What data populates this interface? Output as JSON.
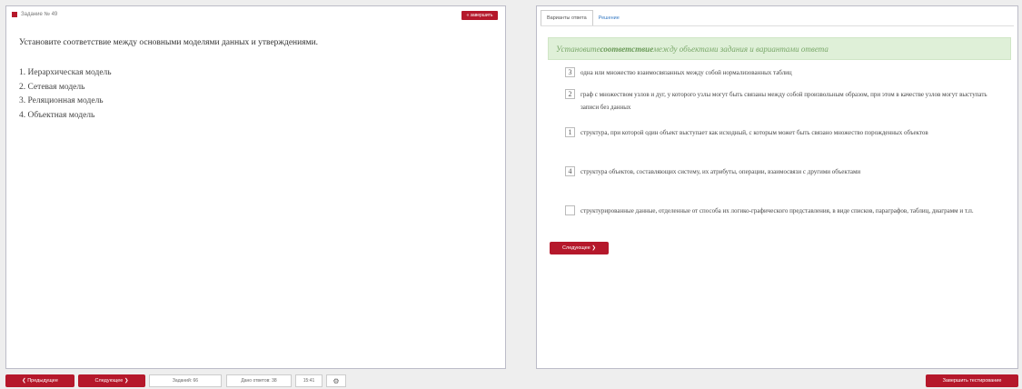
{
  "task": {
    "number_label": "Задание № 49",
    "finish_label": "« завершить",
    "prompt": "Установите соответствие между основными моделями данных и утверждениями.",
    "models": [
      "1. Иерархическая модель",
      "2. Сетевая модель",
      "3. Реляционная модель",
      "4. Объектная модель"
    ]
  },
  "answer_panel": {
    "tabs": [
      {
        "label": "Варианты ответа"
      },
      {
        "label": "Решение"
      }
    ],
    "instruction_pre": "Установите ",
    "instruction_bold": "соответствие",
    "instruction_post": " между объектами задания и вариантами ответа",
    "statements": [
      {
        "value": "3",
        "text": "одна или множество взаимосвязанных между собой нормализованных таблиц"
      },
      {
        "value": "2",
        "text": "граф с множеством узлов и дуг, у которого узлы могут быть связаны между собой произвольным образом, при этом в качестве узлов могут выступать записи без данных"
      },
      {
        "value": "1",
        "text": "структура, при которой один объект выступает как исходный, с которым может быть связано множество порожденных объектов"
      },
      {
        "value": "4",
        "text": "структура объектов, составляющих систему, их атрибуты, операции, взаимосвязи с другими объектами"
      },
      {
        "value": "",
        "text": "структурированные данные, отделенные от способа их логико-графического представления, в виде списков, параграфов, таблиц, диаграмм и т.п."
      }
    ],
    "next_label": "Следующее ❯"
  },
  "bottom_bar": {
    "prev_label": "❮ Предыдущее",
    "next_label": "Следующее ❯",
    "tasks_label": "Заданий: 66",
    "answered_label": "Дано ответов: 38",
    "time_label": "15:41",
    "settings_icon": "gear-icon",
    "finish_test_label": "Завершить тестирование"
  },
  "colors": {
    "accent": "#b5182b",
    "instruction_bg": "#dff0d8",
    "tab_link": "#3a7cc4"
  }
}
